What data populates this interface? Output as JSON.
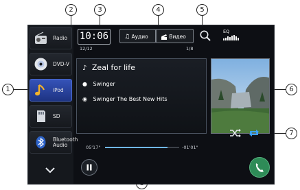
{
  "callouts": [
    "1",
    "2",
    "3",
    "4",
    "5",
    "6",
    "7",
    "8"
  ],
  "clock": "10:06",
  "sources": [
    {
      "label": "Radio"
    },
    {
      "label": "DVD-V"
    },
    {
      "label": "iPod"
    },
    {
      "label": "SD"
    },
    {
      "label": "Bluetooth Audio"
    }
  ],
  "tabs": [
    {
      "label": "Аудио",
      "icon": "music-note-icon"
    },
    {
      "label": "Видео",
      "icon": "film-icon"
    }
  ],
  "eq_label": "EQ",
  "track_index": "12/12",
  "album_index": "1/8",
  "track": {
    "title": "Zeal for life",
    "artist": "Swinger",
    "album": "Swinger The Best New Hits"
  },
  "elapsed": "05'17\"",
  "remaining": "-01'01\"",
  "progress": 0.84,
  "colors": {
    "accent": "#2f57c8",
    "repeat": "#3aa0ff",
    "phone": "#2e8b57"
  }
}
